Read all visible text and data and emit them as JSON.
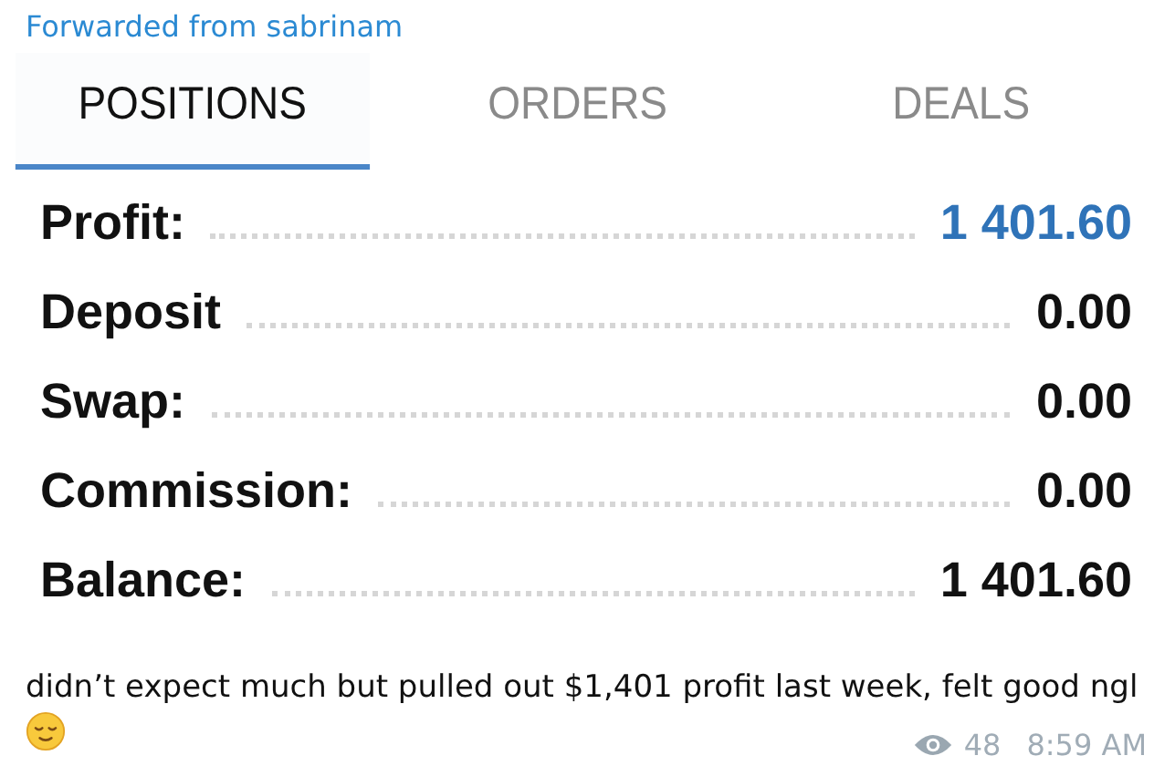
{
  "forwarded_from": "Forwarded from sabrinam",
  "tabs": [
    {
      "label": "POSITIONS",
      "selected": true
    },
    {
      "label": "ORDERS",
      "selected": false
    },
    {
      "label": "DEALS",
      "selected": false
    }
  ],
  "summary": [
    {
      "label": "Profit:",
      "value": "1 401.60",
      "kind": "highlight"
    },
    {
      "label": "Deposit",
      "value": "0.00",
      "kind": "plain"
    },
    {
      "label": "Swap:",
      "value": "0.00",
      "kind": "plain"
    },
    {
      "label": "Commission:",
      "value": "0.00",
      "kind": "plain"
    },
    {
      "label": "Balance:",
      "value": "1 401.60",
      "kind": "plain"
    }
  ],
  "message": "didn’t expect much but pulled out $1,401 profit last week, felt good ngl",
  "views": "48",
  "time": "8:59 AM"
}
